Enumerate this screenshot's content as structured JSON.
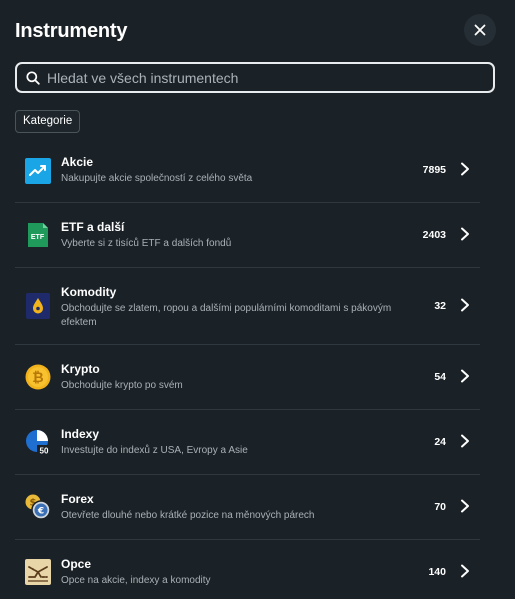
{
  "header": {
    "title": "Instrumenty"
  },
  "search": {
    "placeholder": "Hledat ve všech instrumentech",
    "value": ""
  },
  "filter": {
    "chip_label": "Kategorie"
  },
  "categories": [
    {
      "name": "Akcie",
      "desc": "Nakupujte akcie společností z celého světa",
      "count": "7895",
      "icon": "stocks-trend-icon"
    },
    {
      "name": "ETF a další",
      "desc": "Vyberte si z tisíců ETF a dalších fondů",
      "count": "2403",
      "icon": "etf-icon",
      "icon_text": "ETF"
    },
    {
      "name": "Komodity",
      "desc": "Obchodujte se zlatem, ropou a dalšími populárními komoditami s pákovým efektem",
      "count": "32",
      "icon": "oil-drop-icon"
    },
    {
      "name": "Krypto",
      "desc": "Obchodujte krypto po svém",
      "count": "54",
      "icon": "bitcoin-icon",
      "icon_text": "₿"
    },
    {
      "name": "Indexy",
      "desc": "Investujte do indexů z USA, Evropy a Asie",
      "count": "24",
      "icon": "index-gauge-icon",
      "icon_text": "50"
    },
    {
      "name": "Forex",
      "desc": "Otevřete dlouhé nebo krátké pozice na měnových párech",
      "count": "70",
      "icon": "currency-exchange-icon",
      "icon_text": "€"
    },
    {
      "name": "Opce",
      "desc": "Opce na akcie, indexy a komodity",
      "count": "140",
      "icon": "options-payoff-icon"
    }
  ],
  "colors": {
    "background": "#1b2227",
    "stocks": "#1aa6e6",
    "etf": "#1f9a5b",
    "commodities": "#1f2a6b",
    "crypto": "#f2b21b",
    "index": "#1f6fd1",
    "forex": "#e9b93a",
    "options": "#e8d6a8"
  }
}
